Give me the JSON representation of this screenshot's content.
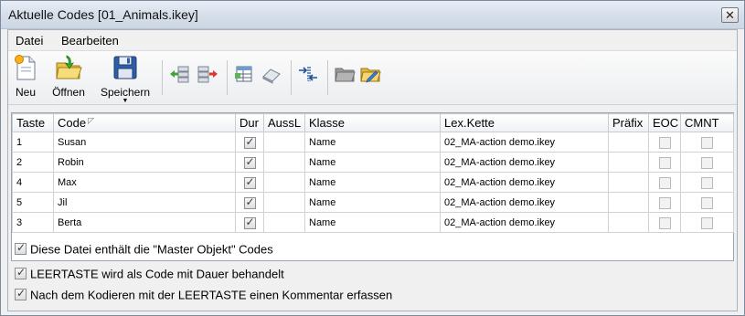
{
  "window": {
    "title": "Aktuelle Codes [01_Animals.ikey]",
    "close_glyph": "✕"
  },
  "menu": [
    {
      "label": "Datei"
    },
    {
      "label": "Bearbeiten"
    }
  ],
  "toolbar": {
    "new_label": "Neu",
    "open_label": "Öffnen",
    "save_label": "Speichern",
    "icons": [
      "new-file-icon",
      "open-folder-icon",
      "save-disk-icon",
      "move-left-icon",
      "move-right-icon",
      "table-edit-icon",
      "eraser-icon",
      "transfer-icon",
      "folder-gray-icon",
      "folder-edit-icon"
    ]
  },
  "table": {
    "columns": [
      "Taste",
      "Code",
      "Dur",
      "AussL",
      "Klasse",
      "Lex.Kette",
      "Präfix",
      "EOC",
      "CMNT"
    ],
    "rows": [
      {
        "taste": "1",
        "code": "Susan",
        "dur": true,
        "aussl": "",
        "klasse": "Name",
        "lex": "02_MA-action demo.ikey",
        "praefix": "",
        "eoc": false,
        "cmnt": false
      },
      {
        "taste": "2",
        "code": "Robin",
        "dur": true,
        "aussl": "",
        "klasse": "Name",
        "lex": "02_MA-action demo.ikey",
        "praefix": "",
        "eoc": false,
        "cmnt": false
      },
      {
        "taste": "4",
        "code": "Max",
        "dur": true,
        "aussl": "",
        "klasse": "Name",
        "lex": "02_MA-action demo.ikey",
        "praefix": "",
        "eoc": false,
        "cmnt": false
      },
      {
        "taste": "5",
        "code": "Jil",
        "dur": true,
        "aussl": "",
        "klasse": "Name",
        "lex": "02_MA-action demo.ikey",
        "praefix": "",
        "eoc": false,
        "cmnt": false
      },
      {
        "taste": "3",
        "code": "Berta",
        "dur": true,
        "aussl": "",
        "klasse": "Name",
        "lex": "02_MA-action demo.ikey",
        "praefix": "",
        "eoc": false,
        "cmnt": false
      }
    ]
  },
  "options": [
    {
      "label": "Diese Datei enthält die \"Master Objekt\" Codes",
      "checked": true
    },
    {
      "label": "LEERTASTE wird als Code mit Dauer behandelt",
      "checked": true
    },
    {
      "label": "Nach dem Kodieren mit der LEERTASTE einen Kommentar erfassen",
      "checked": true
    }
  ]
}
